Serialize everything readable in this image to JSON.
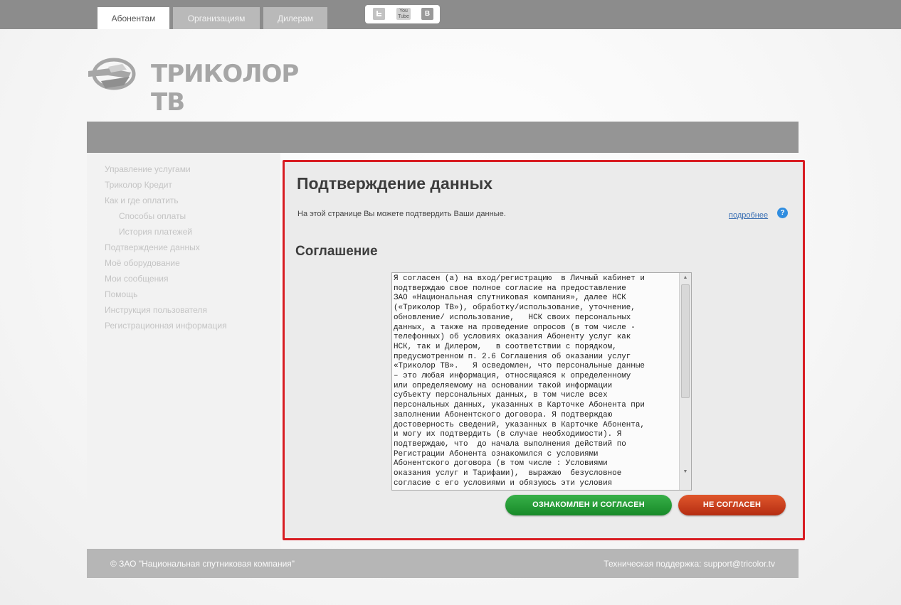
{
  "header": {
    "tabs": [
      {
        "label": "Абонентам",
        "active": true
      },
      {
        "label": "Организациям",
        "active": false
      },
      {
        "label": "Дилерам",
        "active": false
      }
    ],
    "social": {
      "twitter_icon": "twitter-icon",
      "youtube_label": "You Tube",
      "vk_label": "В"
    }
  },
  "logo": {
    "text": "ТРИКОЛОР ТВ"
  },
  "sidebar": {
    "items": [
      {
        "label": "Управление услугами",
        "sub": false
      },
      {
        "label": "Триколор Кредит",
        "sub": false
      },
      {
        "label": "Как и где оплатить",
        "sub": false
      },
      {
        "label": "Способы оплаты",
        "sub": true
      },
      {
        "label": "История платежей",
        "sub": true
      },
      {
        "label": "Подтверждение данных",
        "sub": false
      },
      {
        "label": "Моё оборудование",
        "sub": false
      },
      {
        "label": "Мои сообщения",
        "sub": false
      },
      {
        "label": "Помощь",
        "sub": false
      },
      {
        "label": "Инструкция пользователя",
        "sub": false
      },
      {
        "label": "Регистрационная информация",
        "sub": false
      }
    ]
  },
  "main": {
    "title": "Подтверждение данных",
    "intro": "На этой странице Вы можете подтвердить Ваши данные.",
    "more_link": "подробнее",
    "help_icon": "?",
    "section_title": "Соглашение",
    "agreement_text": "Я согласен (а) на вход/регистрацию  в Личный кабинет и\nподтверждаю свое полное согласие на предоставление\nЗАО «Национальная спутниковая компания», далее НСК\n(«Триколор ТВ»), обработку/использование, уточнение,\nобновление/ использование,   НСК своих персональных\nданных, а также на проведение опросов (в том числе -\nтелефонных) об условиях оказания Абоненту услуг как\nНСК, так и Дилером,   в соответствии с порядком,\nпредусмотренном п. 2.6 Соглашения об оказании услуг\n«Триколор ТВ».   Я осведомлен, что персональные данные\n– это любая информация, относящаяся к определенному\nили определяемому на основании такой информации\nсубъекту персональных данных, в том числе всех\nперсональных данных, указанных в Карточке Абонента при\nзаполнении Абонентского договора. Я подтверждаю\nдостоверность сведений, указанных в Карточке Абонента,\nи могу их подтвердить (в случае необходимости). Я\nподтверждаю, что  до начала выполнения действий по\nРегистрации Абонента ознакомился с условиями\nАбонентского договора (в том числе : Условиями\nоказания услуг и Тарифами),  выражаю  безусловное\nсогласие с его условиями и обязуюсь эти условия",
    "agree_button": "ОЗНАКОМЛЕН И СОГЛАСЕН",
    "disagree_button": "НЕ СОГЛАСЕН"
  },
  "footer": {
    "copyright": "© ЗАО \"Национальная спутниковая компания\"",
    "support": "Техническая поддержка: support@tricolor.tv"
  },
  "colors": {
    "accent_border": "#d81d23",
    "agree_green": "#178a28",
    "disagree_red": "#b52d12",
    "link_blue": "#3a6fb3"
  }
}
